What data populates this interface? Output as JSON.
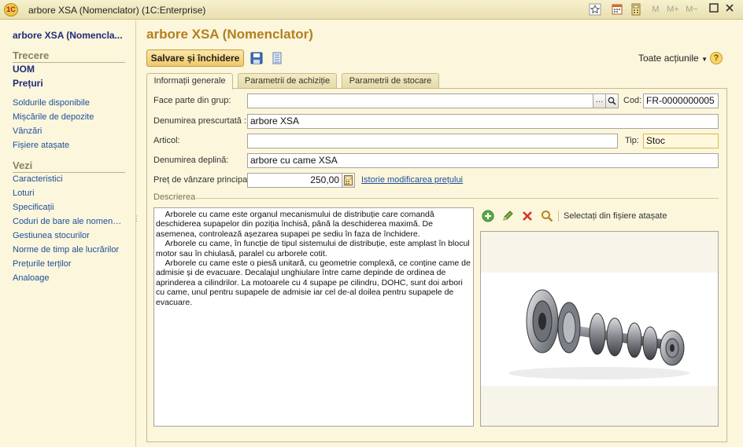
{
  "window": {
    "title": "arbore XSA (Nomenclator)  (1C:Enterprise)",
    "logo_text": "1С",
    "toolbar_icons": [
      "star-icon",
      "calendar-icon",
      "calculator-icon"
    ],
    "memory_buttons": [
      "M",
      "M+",
      "M−"
    ]
  },
  "sidebar": {
    "title": "arbore XSA (Nomencla...",
    "section_trecere": "Trecere",
    "bold_links": [
      "UOM",
      "Prețuri"
    ],
    "links_a": [
      "Soldurile disponibile",
      "Mișcările de depozite",
      "Vânzări",
      "Fișiere atașate"
    ],
    "section_vezi": "Vezi",
    "links_b": [
      "Caracteristici",
      "Loturi",
      "Specificații",
      "Coduri de bare ale nomencl...",
      "Gestiunea stocurilor",
      "Norme de timp ale lucrărilor",
      "Prețurile terților",
      "Analoage"
    ]
  },
  "main": {
    "title": "arbore XSA (Nomenclator)",
    "save_close": "Salvare și închidere",
    "all_actions": "Toate acțiunile",
    "help": "?",
    "tabs": [
      "Informații generale",
      "Parametrii de achiziție",
      "Parametrii de stocare"
    ],
    "active_tab": 0
  },
  "form": {
    "group_label": "Face parte din grup:",
    "group_value": "",
    "code_label": "Cod:",
    "code_value": "FR-0000000005",
    "short_name_label": "Denumirea prescurtată :",
    "short_name_value": "arbore XSA",
    "article_label": "Articol:",
    "article_value": "",
    "type_label": "Tip:",
    "type_value": "Stoc",
    "full_name_label": "Denumirea deplină:",
    "full_name_value": "arbore cu came XSA",
    "price_label": "Preț de vânzare principal:",
    "price_value": "250,00",
    "price_history_link": "Istorie modificarea prețului",
    "description_legend": "Descrierea",
    "description_text": "    Arborele cu came este organul mecanismului de distribuție care comandă deschiderea supapelor din poziția închisă, până la deschiderea maximă. De asemenea, controlează așezarea supapei pe sediu în faza de închidere.\n    Arborele cu came, în funcție de tipul sistemului de distribuție, este amplast în blocul motor sau în chiulasă, paralel cu arborele cotit.\n    Arborele cu came este o piesă unitară, cu geometrie complexă, ce conține came de admisie și de evacuare. Decalajul unghiulare între came depinde de ordinea de aprinderea a cilindrilor. La motoarele cu 4 supape pe cilindru, DOHC, sunt doi arbori cu came, unul pentru supapele de admisie iar cel de-al doilea pentru supapele de evacuare.",
    "select_from_files": "Selectați din fișiere atașate"
  }
}
